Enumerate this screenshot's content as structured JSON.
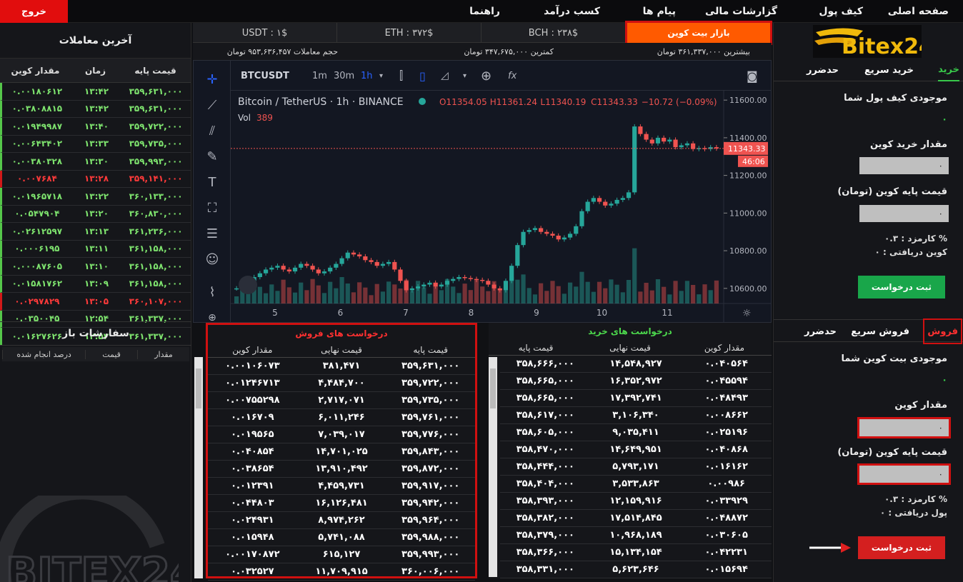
{
  "nav": {
    "logout": "خروج",
    "items": [
      "صفحه اصلی",
      "کیف پول",
      "گزارشات مالی",
      "پیام ها",
      "کسب درآمد",
      "راهنما"
    ]
  },
  "trades": {
    "title": "آخرین معاملات",
    "headers": [
      "قیمت پایه",
      "زمان",
      "مقدار کوین"
    ],
    "rows": [
      {
        "price": "۳۵۹,۶۳۱,۰۰۰",
        "time": "۱۳:۴۲",
        "amount": "۰.۰۰۱۸۰۶۱۲",
        "dir": "up"
      },
      {
        "price": "۳۵۹,۶۳۱,۰۰۰",
        "time": "۱۳:۴۲",
        "amount": "۰.۰۳۸۰۸۸۱۵",
        "dir": "up"
      },
      {
        "price": "۳۵۹,۷۲۲,۰۰۰",
        "time": "۱۳:۴۰",
        "amount": "۰.۰۱۹۴۹۹۸۷",
        "dir": "up"
      },
      {
        "price": "۳۵۹,۷۳۵,۰۰۰",
        "time": "۱۳:۳۳",
        "amount": "۰.۰۰۶۴۳۴۰۲",
        "dir": "up"
      },
      {
        "price": "۳۵۹,۹۹۳,۰۰۰",
        "time": "۱۳:۳۰",
        "amount": "۰.۰۰۳۸۰۳۲۸",
        "dir": "up"
      },
      {
        "price": "۳۵۹,۱۴۱,۰۰۰",
        "time": "۱۳:۲۸",
        "amount": "۰.۰۰۷۶۸۴",
        "dir": "down"
      },
      {
        "price": "۳۶۰,۱۳۳,۰۰۰",
        "time": "۱۳:۲۲",
        "amount": "۰.۰۱۹۶۵۷۱۸",
        "dir": "up"
      },
      {
        "price": "۳۶۰,۸۳۰,۰۰۰",
        "time": "۱۳:۲۰",
        "amount": "۰.۰۵۴۷۹۰۴",
        "dir": "up"
      },
      {
        "price": "۳۶۱,۲۳۶,۰۰۰",
        "time": "۱۳:۱۳",
        "amount": "۰.۰۲۶۱۲۵۹۷",
        "dir": "up"
      },
      {
        "price": "۳۶۱,۱۵۸,۰۰۰",
        "time": "۱۳:۱۱",
        "amount": "۰.۰۰۰۶۱۹۵",
        "dir": "up"
      },
      {
        "price": "۳۶۱,۱۵۸,۰۰۰",
        "time": "۱۳:۱۰",
        "amount": "۰.۰۰۰۸۷۶۰۵",
        "dir": "up"
      },
      {
        "price": "۳۶۱,۱۵۸,۰۰۰",
        "time": "۱۳:۰۹",
        "amount": "۰.۰۱۵۸۱۷۶۲",
        "dir": "up"
      },
      {
        "price": "۳۶۰,۱۰۷,۰۰۰",
        "time": "۱۳:۰۵",
        "amount": "۰.۰۲۹۷۸۲۹",
        "dir": "down"
      },
      {
        "price": "۳۶۱,۳۳۷,۰۰۰",
        "time": "۱۲:۵۴",
        "amount": "۰.۰۳۵۰۰۴۵",
        "dir": "up"
      },
      {
        "price": "۳۶۱,۳۳۷,۰۰۰",
        "time": "۱۲:۵۳",
        "amount": "۰.۰۱۶۲۷۶۲۶",
        "dir": "up"
      }
    ]
  },
  "open_orders": {
    "title": "سفارشات باز",
    "headers": [
      "مقدار",
      "قیمت",
      "درصد انجام شده"
    ]
  },
  "watermark_text": "BITEX24",
  "tickers": {
    "usdt": "USDT : ۱$",
    "eth": "ETH : ۳۷۲$",
    "bch": "BCH : ۲۳۸$",
    "market": "بازار بیت کوین"
  },
  "stats": {
    "max": "بیشترین ۳۶۱,۳۳۷,۰۰۰ تومان",
    "min": "کمترین ۳۴۷,۶۷۵,۰۰۰ تومان",
    "volume": "حجم معاملات ۹۵۳,۶۳۶,۴۵۷ تومان"
  },
  "chart_toolbar": {
    "symbol": "BTCUSDT",
    "intervals": [
      "1m",
      "30m",
      "1h"
    ],
    "active_interval": "1h",
    "fx": "fx"
  },
  "chart_legend": {
    "title": "Bitcoin / TetherUS · 1h · BINANCE",
    "o": "O11354.05",
    "h": "H11361.24",
    "l": "L11340.19",
    "c": "C11343.33",
    "chg": "−10.72 (−0.09%)",
    "vol_label": "Vol",
    "vol_value": "389"
  },
  "chart_data": {
    "type": "candlestick",
    "x_ticks": [
      "5",
      "6",
      "7",
      "8",
      "9",
      "10",
      "11"
    ],
    "y_ticks": [
      "11600.00",
      "11400.00",
      "11200.00",
      "11000.00",
      "10800.00",
      "10600.00"
    ],
    "ylim": [
      10550,
      11650
    ],
    "last_price": "11343.33",
    "countdown": "46:06",
    "close_path": [
      10600,
      10620,
      10640,
      10660,
      10680,
      10700,
      10710,
      10720,
      10700,
      10690,
      10710,
      10730,
      10720,
      10700,
      10680,
      10690,
      10710,
      10730,
      10760,
      10790,
      10780,
      10770,
      10750,
      10740,
      10720,
      10730,
      10740,
      10700,
      10640,
      10590,
      10600,
      10610,
      10620,
      10630,
      10610,
      10620,
      10640,
      10650,
      10660,
      10655,
      10650,
      10645,
      10640,
      10620,
      10600,
      10590,
      10640,
      10720,
      10830,
      10900,
      10910,
      10920,
      10900,
      10890,
      10880,
      10860,
      10870,
      10890,
      10930,
      11010,
      11060,
      11080,
      11060,
      11040,
      11050,
      11070,
      11080,
      11110,
      11460,
      11420,
      11390,
      11370,
      11400,
      11380,
      11390,
      11350,
      11360,
      11370,
      11340,
      11345,
      11340,
      11350,
      11343
    ]
  },
  "sell_book": {
    "title": "درخواست های فروش",
    "headers": [
      "قیمت پایه",
      "قیمت نهایی",
      "مقدار کوین"
    ],
    "rows": [
      [
        "۳۵۹,۶۳۱,۰۰۰",
        "۳۸۱,۴۷۱",
        "۰.۰۰۱۰۶۰۷۳"
      ],
      [
        "۳۵۹,۷۲۲,۰۰۰",
        "۴,۴۸۴,۷۰۰",
        "۰.۰۱۲۴۶۷۱۳"
      ],
      [
        "۳۵۹,۷۳۵,۰۰۰",
        "۲,۷۱۷,۰۷۱",
        "۰.۰۰۷۵۵۲۹۸"
      ],
      [
        "۳۵۹,۷۶۱,۰۰۰",
        "۶,۰۱۱,۲۴۶",
        "۰.۰۱۶۷۰۹"
      ],
      [
        "۳۵۹,۷۷۶,۰۰۰",
        "۷,۰۳۹,۰۱۷",
        "۰.۰۱۹۵۶۵"
      ],
      [
        "۳۵۹,۸۴۳,۰۰۰",
        "۱۴,۷۰۱,۰۲۵",
        "۰.۰۴۰۸۵۴"
      ],
      [
        "۳۵۹,۸۷۲,۰۰۰",
        "۱۳,۹۱۰,۴۹۲",
        "۰.۰۳۸۶۵۴"
      ],
      [
        "۳۵۹,۹۱۷,۰۰۰",
        "۴,۴۵۹,۷۳۱",
        "۰.۰۱۲۳۹۱"
      ],
      [
        "۳۵۹,۹۴۲,۰۰۰",
        "۱۶,۱۲۶,۴۸۱",
        "۰.۰۴۴۸۰۳"
      ],
      [
        "۳۵۹,۹۶۴,۰۰۰",
        "۸,۹۷۴,۲۶۲",
        "۰.۰۲۴۹۳۱"
      ],
      [
        "۳۵۹,۹۸۸,۰۰۰",
        "۵,۷۴۱,۰۸۸",
        "۰.۰۱۵۹۴۸"
      ],
      [
        "۳۵۹,۹۹۳,۰۰۰",
        "۶۱۵,۱۲۷",
        "۰.۰۰۱۷۰۸۷۲"
      ],
      [
        "۳۶۰,۰۰۶,۰۰۰",
        "۱۱,۷۰۹,۹۱۵",
        "۰.۰۳۲۵۲۷"
      ]
    ]
  },
  "buy_book": {
    "title": "درخواست های خرید",
    "headers": [
      "قیمت پایه",
      "قیمت نهایی",
      "مقدار کوین"
    ],
    "rows": [
      [
        "۳۵۸,۶۶۶,۰۰۰",
        "۱۴,۵۴۸,۹۲۷",
        "۰.۰۴۰۵۶۴"
      ],
      [
        "۳۵۸,۶۶۵,۰۰۰",
        "۱۶,۳۵۲,۹۷۲",
        "۰.۰۴۵۵۹۴"
      ],
      [
        "۳۵۸,۶۶۵,۰۰۰",
        "۱۷,۳۹۲,۷۴۱",
        "۰.۰۴۸۴۹۳"
      ],
      [
        "۳۵۸,۶۱۷,۰۰۰",
        "۳,۱۰۶,۳۴۰",
        "۰.۰۰۸۶۶۲"
      ],
      [
        "۳۵۸,۶۰۵,۰۰۰",
        "۹,۰۳۵,۴۱۱",
        "۰.۰۲۵۱۹۶"
      ],
      [
        "۳۵۸,۴۷۰,۰۰۰",
        "۱۴,۶۴۹,۹۵۱",
        "۰.۰۴۰۸۶۸"
      ],
      [
        "۳۵۸,۴۴۴,۰۰۰",
        "۵,۷۹۳,۱۷۱",
        "۰.۰۱۶۱۶۲"
      ],
      [
        "۳۵۸,۴۰۴,۰۰۰",
        "۳,۵۳۳,۸۶۳",
        "۰.۰۰۹۸۶"
      ],
      [
        "۳۵۸,۳۹۳,۰۰۰",
        "۱۲,۱۵۹,۹۱۶",
        "۰.۰۳۳۹۲۹"
      ],
      [
        "۳۵۸,۳۸۲,۰۰۰",
        "۱۷,۵۱۴,۸۴۵",
        "۰.۰۴۸۸۷۲"
      ],
      [
        "۳۵۸,۳۷۹,۰۰۰",
        "۱۰,۹۶۸,۱۸۹",
        "۰.۰۳۰۶۰۵"
      ],
      [
        "۳۵۸,۳۶۶,۰۰۰",
        "۱۵,۱۳۴,۱۵۴",
        "۰.۰۴۲۲۳۱"
      ],
      [
        "۳۵۸,۳۳۱,۰۰۰",
        "۵,۶۲۳,۶۴۶",
        "۰.۰۱۵۶۹۴"
      ]
    ]
  },
  "buy_panel": {
    "logo": "Bitex24",
    "tabs": [
      "خرید",
      "خرید سریع",
      "حدضرر"
    ],
    "wallet_label": "موجودی کیف پول شما",
    "wallet_value": "۰",
    "amount_label": "مقدار خرید کوین",
    "amount_value": "۰",
    "price_label": "قیمت پایه کوین (تومان)",
    "price_value": "۰",
    "fee": "کارمزد : ۰.۳ %",
    "received": "کوین دریافتی : ۰",
    "submit": "ثبت درخواست",
    "color": "#19a64a"
  },
  "sell_panel": {
    "tabs": [
      "فروش",
      "فروش سریع",
      "حدضرر"
    ],
    "wallet_label": "موجودی بیت کوین شما",
    "wallet_value": "۰",
    "amount_label": "مقدار کوین",
    "amount_value": "۰",
    "price_label": "قیمت پایه کوین (تومان)",
    "price_value": "۰",
    "fee": "کارمزد : ۰.۳ %",
    "received": "پول دریافتی : ۰",
    "submit": "ثبت درخواست",
    "color": "#d41f1f"
  }
}
